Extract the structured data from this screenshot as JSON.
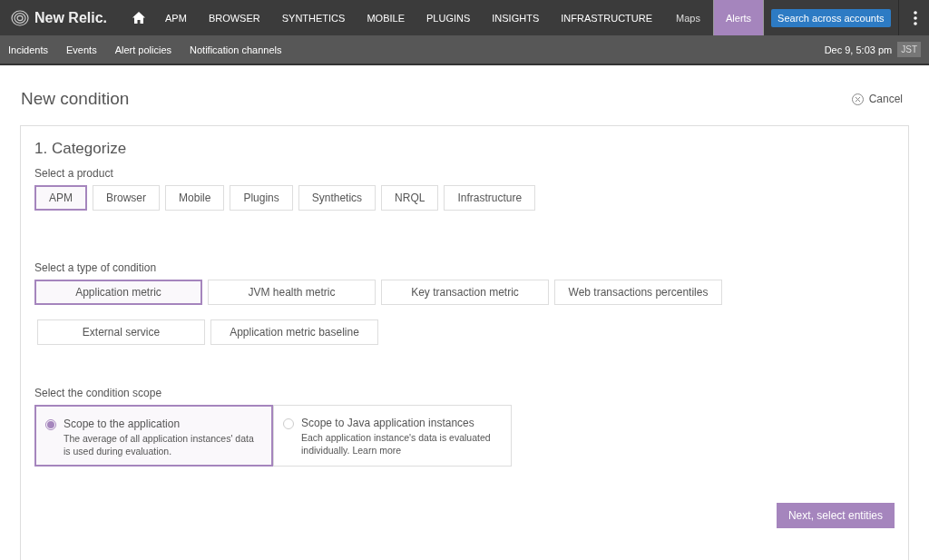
{
  "topnav": {
    "brand": "New Relic.",
    "items": [
      {
        "label": "APM",
        "selected": false
      },
      {
        "label": "BROWSER",
        "selected": false
      },
      {
        "label": "SYNTHETICS",
        "selected": false
      },
      {
        "label": "MOBILE",
        "selected": false
      },
      {
        "label": "PLUGINS",
        "selected": false
      },
      {
        "label": "INSIGHTS",
        "selected": false
      },
      {
        "label": "INFRASTRUCTURE",
        "selected": false
      }
    ],
    "right_items": [
      {
        "label": "Maps",
        "selected": false
      },
      {
        "label": "Alerts",
        "selected": true
      }
    ],
    "search_button": "Search across accounts"
  },
  "subnav": {
    "items": [
      "Incidents",
      "Events",
      "Alert policies",
      "Notification channels"
    ],
    "datetime": "Dec 9, 5:03 pm",
    "timezone": "JST"
  },
  "page": {
    "title": "New condition",
    "cancel": "Cancel"
  },
  "section": {
    "title": "1. Categorize",
    "product_label": "Select a product",
    "products": [
      {
        "label": "APM",
        "selected": true
      },
      {
        "label": "Browser",
        "selected": false
      },
      {
        "label": "Mobile",
        "selected": false
      },
      {
        "label": "Plugins",
        "selected": false
      },
      {
        "label": "Synthetics",
        "selected": false
      },
      {
        "label": "NRQL",
        "selected": false
      },
      {
        "label": "Infrastructure",
        "selected": false
      }
    ],
    "type_label": "Select a type of condition",
    "types": [
      {
        "label": "Application metric",
        "selected": true
      },
      {
        "label": "JVM health metric",
        "selected": false
      },
      {
        "label": "Key transaction metric",
        "selected": false
      },
      {
        "label": "Web transactions percentiles",
        "selected": false
      },
      {
        "label": "External service",
        "selected": false
      },
      {
        "label": "Application metric baseline",
        "selected": false
      }
    ],
    "scope_label": "Select the condition scope",
    "scopes": [
      {
        "title": "Scope to the application",
        "description": "The average of all application instances' data is used during evaluation.",
        "selected": true
      },
      {
        "title": "Scope to Java application instances",
        "description": "Each application instance's data is evaluated individually.",
        "link": "Learn more",
        "selected": false
      }
    ],
    "next_button": "Next, select entities"
  }
}
